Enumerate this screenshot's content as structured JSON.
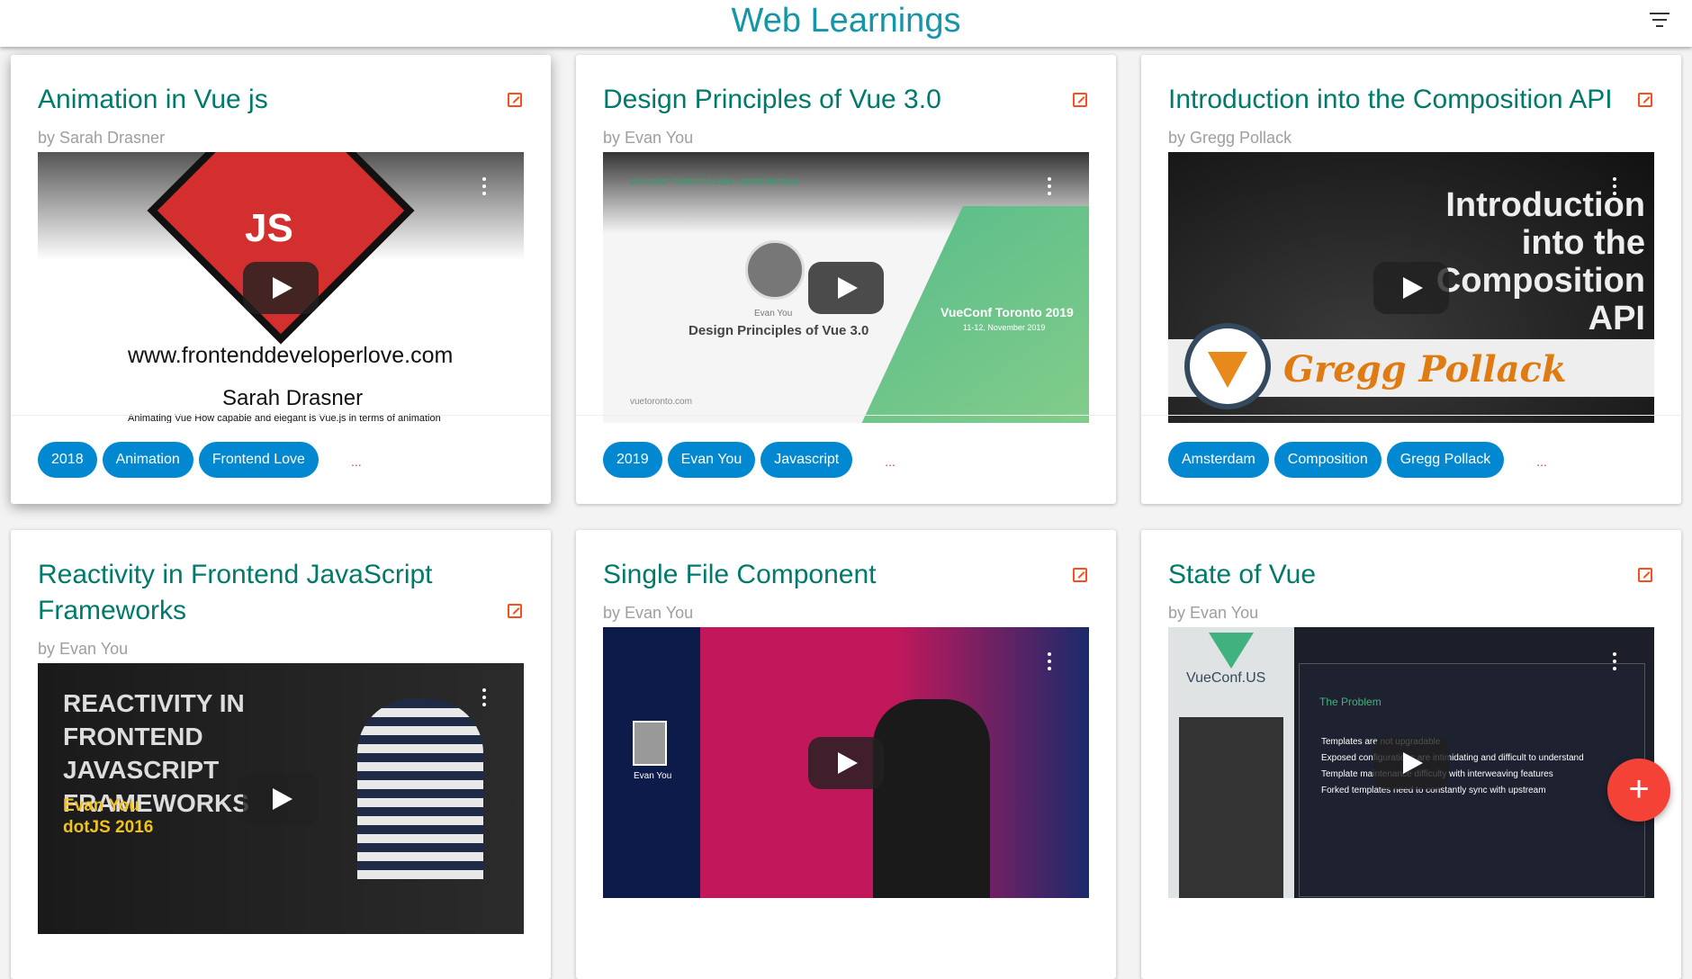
{
  "header": {
    "title": "Web Learnings"
  },
  "cards": [
    {
      "title": "Animation in Vue js",
      "author": "by Sarah Drasner",
      "tags": [
        "2018",
        "Animation",
        "Frontend Love"
      ],
      "more": "...",
      "thumb": {
        "t1": "JS",
        "t2": "www.frontenddeveloperlove.com",
        "t3": "Sarah Drasner",
        "t4": "Animating Vue How capable and elegant is Vue.js in terms of animation"
      }
    },
    {
      "title": "Design Principles of Vue 3.0",
      "author": "by Evan You",
      "tags": [
        "2019",
        "Evan You",
        "Javascript"
      ],
      "more": "...",
      "thumb": {
        "t1": "VUECONF TORONTO 2019 - SESSION TALK",
        "t2": "Evan You",
        "t3": "Design Principles of Vue 3.0",
        "t4": "VueConf Toronto 2019",
        "t5": "11-12, November 2019",
        "t6": "vuetoronto.com"
      }
    },
    {
      "title": "Introduction into the Composition API",
      "author": "by Gregg Pollack",
      "tags": [
        "Amsterdam",
        "Composition",
        "Gregg Pollack"
      ],
      "more": "...",
      "thumb": {
        "t1": "Introduction into the Composition API",
        "t2": "Gregg Pollack"
      }
    },
    {
      "title": "Reactivity in Frontend JavaScript Frameworks",
      "author": "by Evan You",
      "tags": [],
      "thumb": {
        "t1": "REACTIVITY IN FRONTEND JAVASCRIPT FRAMEWORKS",
        "t2": "Evan You",
        "t3": "dotJS 2016"
      }
    },
    {
      "title": "Single File Component",
      "author": "by Evan You",
      "tags": [],
      "thumb": {
        "t1": "Evan You"
      }
    },
    {
      "title": "State of Vue",
      "author": "by Evan You",
      "tags": [],
      "thumb": {
        "t1": "VueConf.US",
        "t2": "The Problem",
        "t3": "Templates are not upgradable",
        "t4": "Exposed configurations are intimidating and difficult to understand",
        "t5": "Template maintenance difficulty with interweaving features",
        "t6": "Forked templates need to constantly sync with upstream"
      }
    }
  ],
  "fab": {
    "label": "+"
  }
}
